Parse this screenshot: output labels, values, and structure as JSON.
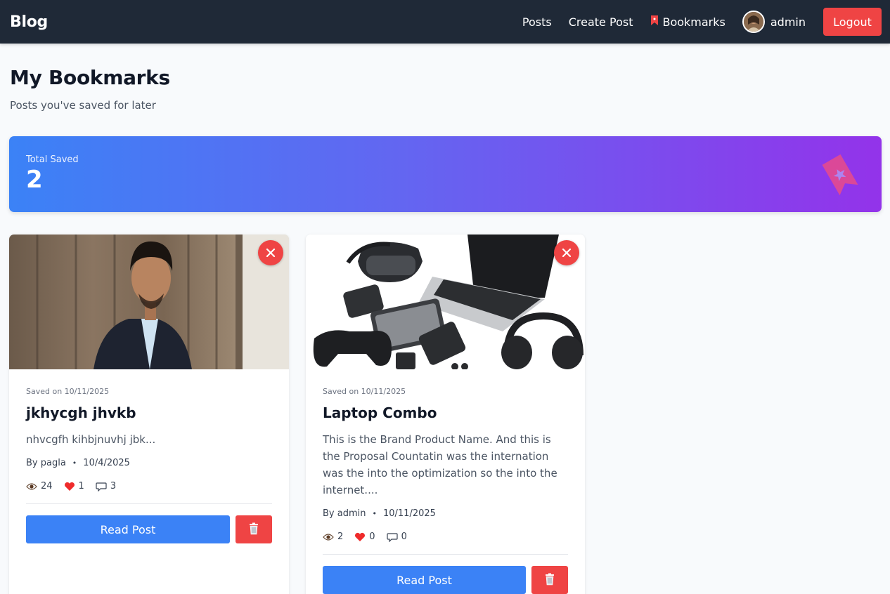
{
  "navbar": {
    "brand": "Blog",
    "links": [
      {
        "label": "Posts"
      },
      {
        "label": "Create Post"
      },
      {
        "label": "Bookmarks",
        "icon": "bookmark-icon"
      }
    ],
    "user": {
      "name": "admin",
      "avatar": "avatar"
    },
    "logout_label": "Logout"
  },
  "header": {
    "title": "My Bookmarks",
    "subtitle": "Posts you've saved for later"
  },
  "stats": {
    "label": "Total Saved",
    "value": "2",
    "icon": "bookmark-icon"
  },
  "bookmarks": [
    {
      "image": "portrait-photo",
      "saved_on": "Saved on 10/11/2025",
      "title": "jkhycgh jhvkb",
      "excerpt": "nhvcgfh kihbjnuvhj jbk...",
      "author": "By pagla",
      "date": "10/4/2025",
      "views": "24",
      "likes": "1",
      "comments": "3",
      "read_label": "Read Post"
    },
    {
      "image": "gadgets-photo",
      "saved_on": "Saved on 10/11/2025",
      "title": "Laptop Combo",
      "excerpt": "This is the Brand Product Name. And this is the Proposal Countatin was the internation was the into the optimization so the into the internet....",
      "author": "By admin",
      "date": "10/11/2025",
      "views": "2",
      "likes": "0",
      "comments": "0",
      "read_label": "Read Post"
    }
  ],
  "colors": {
    "navbar": "#1f2937",
    "primary": "#3b82f6",
    "danger": "#ef4444",
    "gradient_start": "#3b82f6",
    "gradient_end": "#9333ea"
  }
}
